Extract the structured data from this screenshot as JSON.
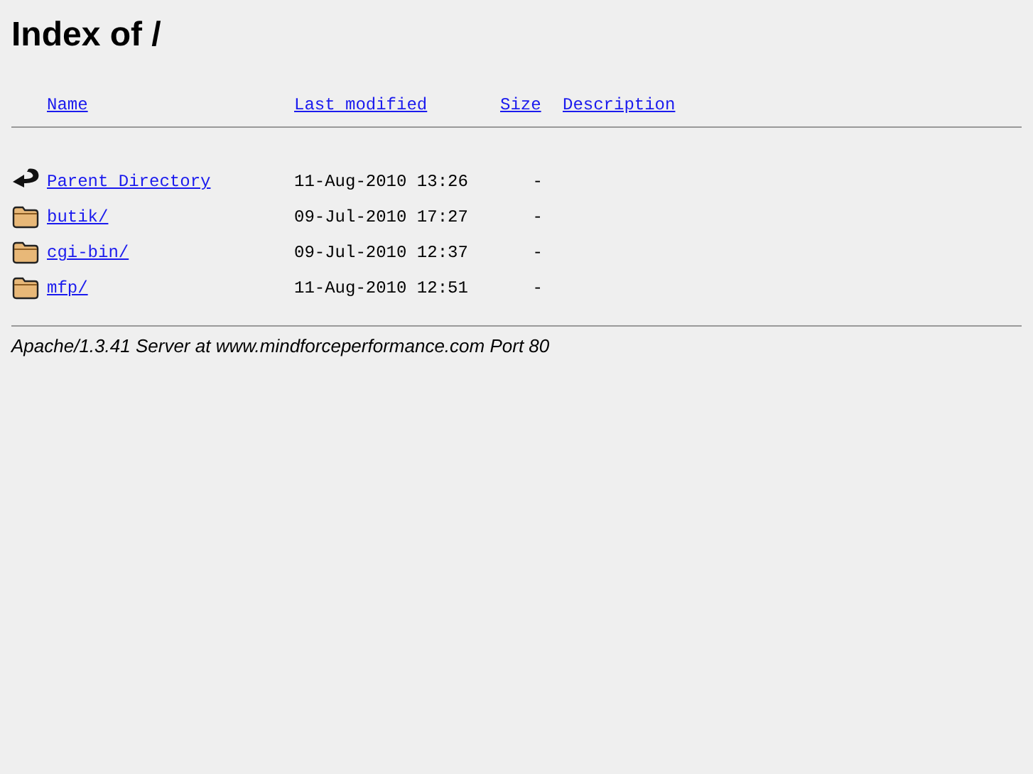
{
  "title": "Index of /",
  "columns": [
    "Name",
    "Last modified",
    "Size",
    "Description"
  ],
  "entries": [
    {
      "kind": "parent",
      "name": "Parent Directory",
      "modified": "11-Aug-2010 13:26",
      "size": "-"
    },
    {
      "kind": "folder",
      "name": "butik/",
      "modified": "09-Jul-2010 17:27",
      "size": "-"
    },
    {
      "kind": "folder",
      "name": "cgi-bin/",
      "modified": "09-Jul-2010 12:37",
      "size": "-"
    },
    {
      "kind": "folder",
      "name": "mfp/",
      "modified": "11-Aug-2010 12:51",
      "size": "-"
    }
  ],
  "address": "Apache/1.3.41 Server at www.mindforceperformance.com Port 80"
}
